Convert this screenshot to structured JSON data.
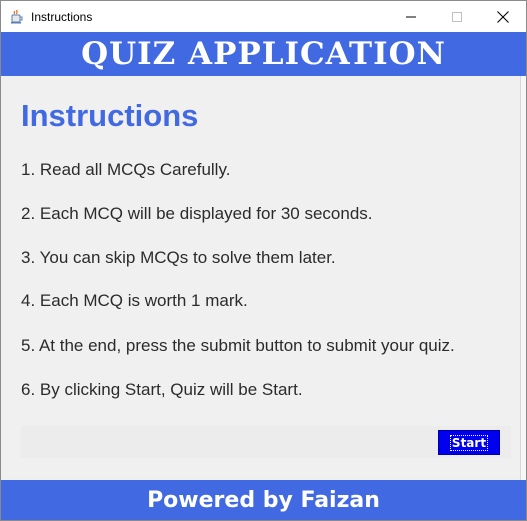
{
  "window": {
    "title": "Instructions",
    "icons": {
      "app": "java-cup-icon",
      "minimize": "minimize-icon",
      "maximize": "maximize-icon",
      "close": "close-icon"
    }
  },
  "header": {
    "title": "QUIZ APPLICATION"
  },
  "main": {
    "heading": "Instructions",
    "instructions": [
      "1. Read all MCQs Carefully.",
      "2. Each MCQ will be displayed for 30 seconds.",
      "3. You can skip MCQs to solve them later.",
      "4. Each MCQ is worth 1 mark.",
      "5. At the end, press the submit button to submit your quiz.",
      "6. By clicking Start, Quiz will be Start."
    ],
    "start_label": "Start"
  },
  "footer": {
    "text": "Powered by Faizan"
  },
  "colors": {
    "accent": "#4169e1",
    "button": "#0000ee",
    "text": "#2b2b2b"
  }
}
